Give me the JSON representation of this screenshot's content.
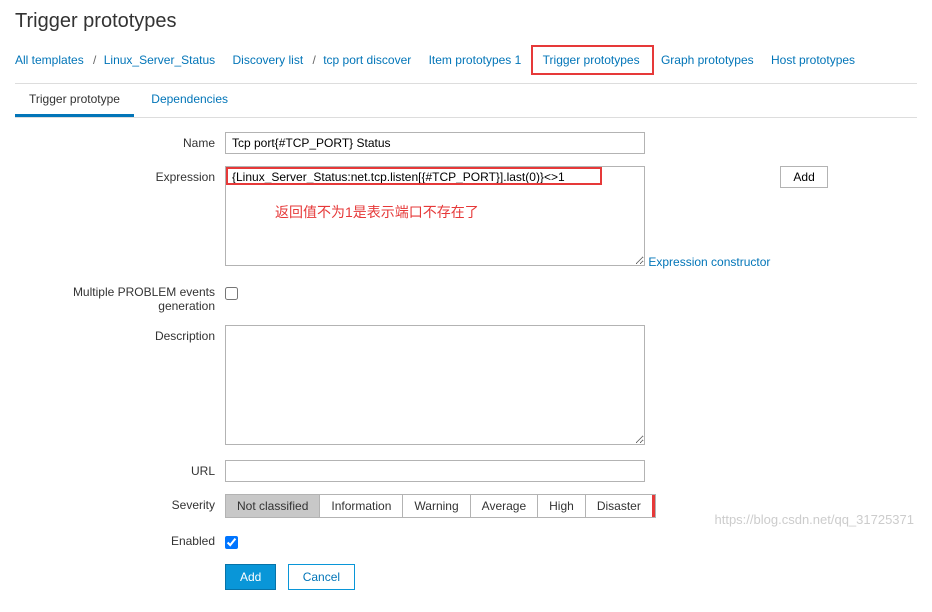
{
  "page_title": "Trigger prototypes",
  "breadcrumb": {
    "all_templates": "All templates",
    "template_name": "Linux_Server_Status",
    "discovery_list": "Discovery list",
    "discovery_rule": "tcp port discover",
    "item_prototypes": "Item prototypes 1",
    "trigger_prototypes": "Trigger prototypes",
    "graph_prototypes": "Graph prototypes",
    "host_prototypes": "Host prototypes"
  },
  "tabs": {
    "trigger_prototype": "Trigger prototype",
    "dependencies": "Dependencies"
  },
  "form": {
    "name_label": "Name",
    "name_value": "Tcp port{#TCP_PORT} Status",
    "expression_label": "Expression",
    "expression_value": "{Linux_Server_Status:net.tcp.listen[{#TCP_PORT}].last(0)}<>1",
    "expression_add_btn": "Add",
    "expression_note": "返回值不为1是表示端口不存在了",
    "expression_constructor": "Expression constructor",
    "multiple_problem_label": "Multiple PROBLEM events generation",
    "description_label": "Description",
    "url_label": "URL",
    "url_value": "",
    "severity_label": "Severity",
    "severity_options": [
      "Not classified",
      "Information",
      "Warning",
      "Average",
      "High",
      "Disaster"
    ],
    "severity_selected": "Not classified",
    "enabled_label": "Enabled",
    "enabled_checked": true,
    "submit_add": "Add",
    "submit_cancel": "Cancel"
  },
  "watermark": "https://blog.csdn.net/qq_31725371"
}
